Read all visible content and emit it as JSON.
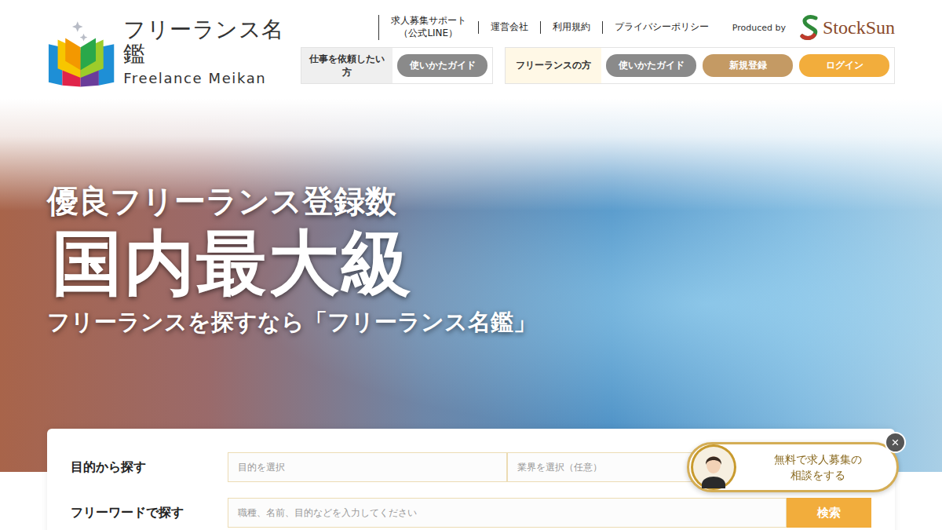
{
  "logo": {
    "title": "フリーランス名鑑",
    "subtitle": "Freelance Meikan"
  },
  "top_links": [
    {
      "lines": [
        "求人募集サポート",
        "（公式LINE）"
      ]
    },
    {
      "lines": [
        "運営会社"
      ]
    },
    {
      "lines": [
        "利用規約"
      ]
    },
    {
      "lines": [
        "プライバシーポリシー"
      ]
    }
  ],
  "produced_by": {
    "label": "Produced by",
    "brand": "StockSun"
  },
  "nav_groups": [
    {
      "label": "仕事を依頼したい方",
      "kind": "client",
      "buttons": [
        {
          "label": "使いかたガイド",
          "color": "#8a8a8a"
        }
      ]
    },
    {
      "label": "フリーランスの方",
      "kind": "freelancer",
      "buttons": [
        {
          "label": "使いかたガイド",
          "color": "#8a8a8a"
        },
        {
          "label": "新規登録",
          "color": "#c49a64"
        },
        {
          "label": "ログイン",
          "color": "#f2ad3c"
        }
      ]
    }
  ],
  "hero": {
    "lead": "優良フリーランス登録数",
    "headline": "国内最大級",
    "tagline": "フリーランスを探すなら「フリーランス名鑑」"
  },
  "search": {
    "rows": [
      {
        "label": "目的から探す",
        "kind": "selects",
        "fields": [
          "目的を選択",
          "業界を選択（任意）"
        ]
      },
      {
        "label": "フリーワードで探す",
        "kind": "text",
        "fields": [
          "職種、名前、目的などを入力してください"
        ],
        "button": "検索"
      }
    ]
  },
  "chat": {
    "lines": [
      "無料で求人募集の",
      "相談をする"
    ],
    "close": "×"
  }
}
